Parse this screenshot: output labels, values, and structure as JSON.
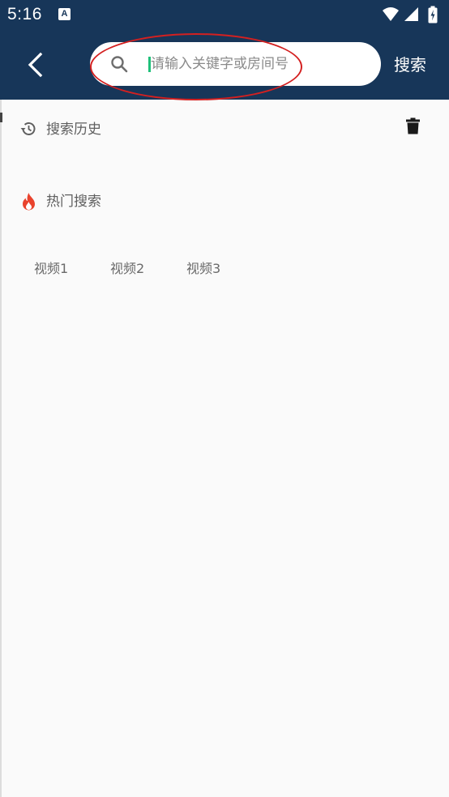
{
  "status_bar": {
    "time": "5:16",
    "notification_badge": "A"
  },
  "header": {
    "search_placeholder": "请输入关键字或房间号",
    "search_value": "",
    "search_button_label": "搜索"
  },
  "history": {
    "title": "搜索历史"
  },
  "hot": {
    "title": "热门搜索",
    "tags": [
      "视频1",
      "视频2",
      "视频3"
    ]
  },
  "colors": {
    "appbar": "#173659",
    "accent_fire": "#e9432d",
    "annotation": "#d42020",
    "caret": "#1fc07a"
  }
}
